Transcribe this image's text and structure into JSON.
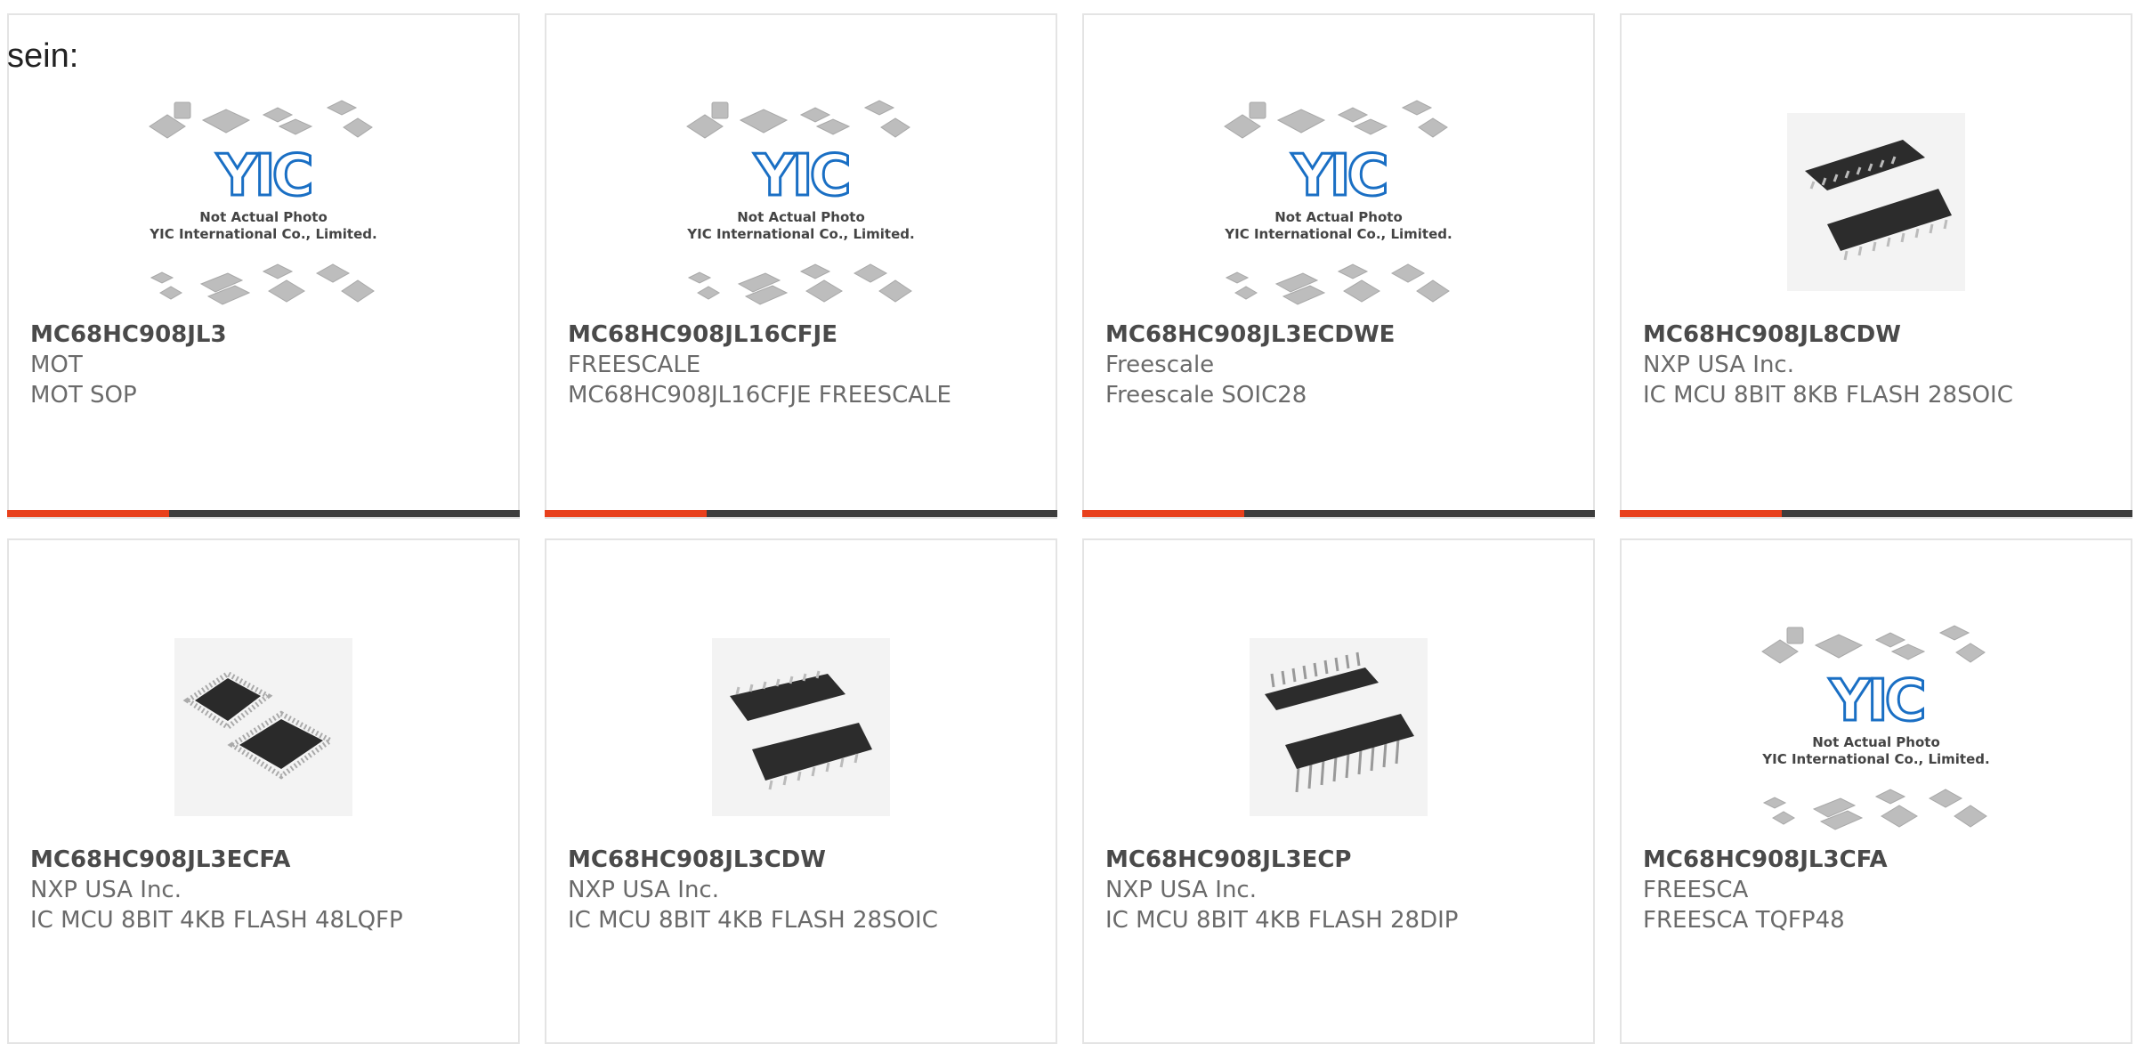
{
  "heading": "sein:",
  "accent_color": "#e8401c",
  "products": [
    {
      "part_number": "MC68HC908JL3",
      "manufacturer": "MOT",
      "description": "MOT SOP",
      "image": "placeholder-not-actual-photo"
    },
    {
      "part_number": "MC68HC908JL16CFJE",
      "manufacturer": "FREESCALE",
      "description": "MC68HC908JL16CFJE FREESCALE",
      "image": "placeholder-not-actual-photo"
    },
    {
      "part_number": "MC68HC908JL3ECDWE",
      "manufacturer": "Freescale",
      "description": "Freescale SOIC28",
      "image": "placeholder-not-actual-photo"
    },
    {
      "part_number": "MC68HC908JL8CDW",
      "manufacturer": "NXP USA Inc.",
      "description": "IC MCU 8BIT 8KB FLASH 28SOIC",
      "image": "soic-chip-photo"
    },
    {
      "part_number": "MC68HC908JL3ECFA",
      "manufacturer": "NXP USA Inc.",
      "description": "IC MCU 8BIT 4KB FLASH 48LQFP",
      "image": "lqfp-chip-photo"
    },
    {
      "part_number": "MC68HC908JL3CDW",
      "manufacturer": "NXP USA Inc.",
      "description": "IC MCU 8BIT 4KB FLASH 28SOIC",
      "image": "soic-chip-photo"
    },
    {
      "part_number": "MC68HC908JL3ECP",
      "manufacturer": "NXP USA Inc.",
      "description": "IC MCU 8BIT 4KB FLASH 28DIP",
      "image": "dip-chip-photo"
    },
    {
      "part_number": "MC68HC908JL3CFA",
      "manufacturer": "FREESCA",
      "description": "FREESCA TQFP48",
      "image": "placeholder-not-actual-photo"
    }
  ],
  "placeholder": {
    "logo_text": "YIC",
    "line1": "Not Actual Photo",
    "line2": "YIC International Co., Limited."
  }
}
